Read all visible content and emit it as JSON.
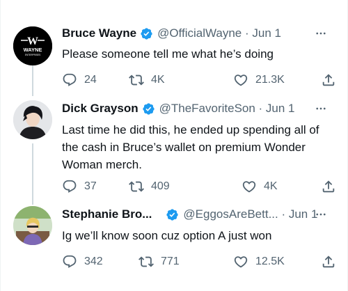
{
  "tweets": [
    {
      "name": "Bruce Wayne",
      "handle": "@OfficialWayne · Jun 1",
      "text": "Please someone tell me what he’s doing",
      "replies": "24",
      "retweets": "4K",
      "likes": "21.3K",
      "avatar": {
        "logo_initial": "W",
        "logo_word": "WAYNE",
        "logo_sub": "ENTERPRISES",
        "bg": "#000000"
      }
    },
    {
      "name": "Dick Grayson",
      "handle": "@TheFavoriteSon · Jun 1",
      "text_lines": [
        "Last time he did this, he ended up spending all of",
        "the cash in Bruce’s wallet on premium Wonder",
        "Woman merch."
      ],
      "replies": "37",
      "retweets": "409",
      "likes": "4K"
    },
    {
      "name": "Stephanie Bro...",
      "handle": "@EggosAreBett... · Jun 1",
      "text": "Ig we’ll know soon cuz option A just won",
      "replies": "342",
      "retweets": "771",
      "likes": "12.5K"
    }
  ],
  "icons": {
    "verified": "verified-badge-icon",
    "more": "more-icon",
    "reply": "reply-icon",
    "retweet": "retweet-icon",
    "like": "like-icon",
    "share": "share-icon"
  },
  "colors": {
    "verified": "#1d9bf0",
    "muted": "#536471",
    "text": "#0f1419",
    "thread_line": "#cfd9de"
  }
}
